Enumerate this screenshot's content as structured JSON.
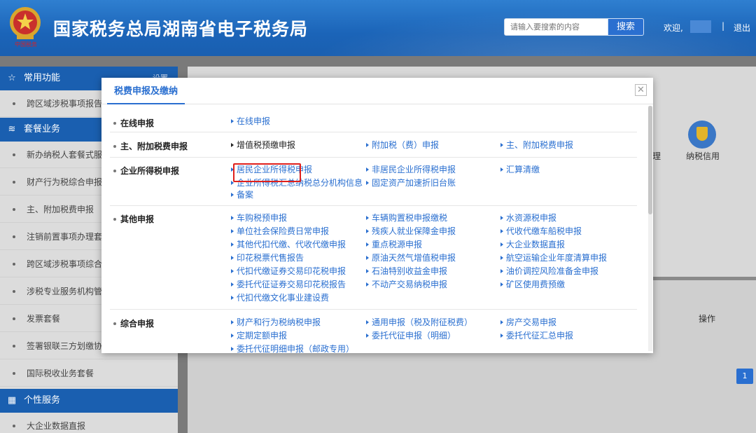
{
  "header": {
    "emblem_caption": "中国税务",
    "title": "国家税务总局湖南省电子税务局",
    "search_placeholder": "请输入要搜索的内容",
    "search_button": "搜索",
    "welcome": "欢迎,",
    "separator": "|",
    "logout": "退出"
  },
  "sidebar": {
    "sections": [
      {
        "title": "常用功能",
        "icon": "star-icon",
        "extra": "设置",
        "items": [
          "跨区域涉税事项报告"
        ]
      },
      {
        "title": "套餐业务",
        "icon": "layers-icon",
        "items": [
          "新办纳税人套餐式服务",
          "财产行为税综合申报",
          "主、附加税费申报",
          "注销前置事项办理套餐",
          "跨区域涉税事项综合办理",
          "涉税专业服务机构管理",
          "发票套餐",
          "签署银联三方划缴协议",
          "国际税收业务套餐"
        ]
      },
      {
        "title": "个性服务",
        "icon": "grid-icon",
        "items": [
          "大企业数据直报"
        ]
      }
    ]
  },
  "background": {
    "label_li": "理",
    "label_credit": "纳税信用",
    "column_op": "操作",
    "page_number": "1"
  },
  "modal": {
    "tab": "税费申报及缴纳",
    "close_glyph": "✕",
    "sections": [
      {
        "label": "在线申报",
        "links": [
          "在线申报"
        ]
      },
      {
        "label": "主、附加税费申报",
        "links": [
          "增值税预缴申报",
          "附加税（费）申报",
          "主、附加税费申报"
        ]
      },
      {
        "label": "企业所得税申报",
        "links": [
          "居民企业所得税申报",
          "非居民企业所得税申报",
          "汇算清缴",
          "企业所得税汇总纳税总分机构信息",
          "固定资产加速折旧台账"
        ],
        "wrap": "备案"
      },
      {
        "label": "其他申报",
        "links": [
          "车购税预申报",
          "车辆购置税申报缴税",
          "水资源税申报",
          "单位社会保险费日常申报",
          "残疾人就业保障金申报",
          "代收代缴车船税申报",
          "其他代扣代缴、代收代缴申报",
          "重点税源申报",
          "大企业数据直报",
          "印花税票代售报告",
          "原油天然气增值税申报",
          "航空运输企业年度清算申报",
          "代扣代缴证券交易印花税申报",
          "石油特别收益金申报",
          "油价调控风险准备金申报",
          "委托代征证券交易印花税报告",
          "不动产交易纳税申报",
          "矿区使用费预缴",
          "代扣代缴文化事业建设费"
        ]
      },
      {
        "label": "综合申报",
        "links": [
          "财产和行为税纳税申报",
          "通用申报（税及附征税费）",
          "房产交易申报",
          "定期定额申报",
          "委托代征申报（明细）",
          "委托代征汇总申报",
          "委托代征明细申报（邮政专用）"
        ]
      }
    ]
  }
}
